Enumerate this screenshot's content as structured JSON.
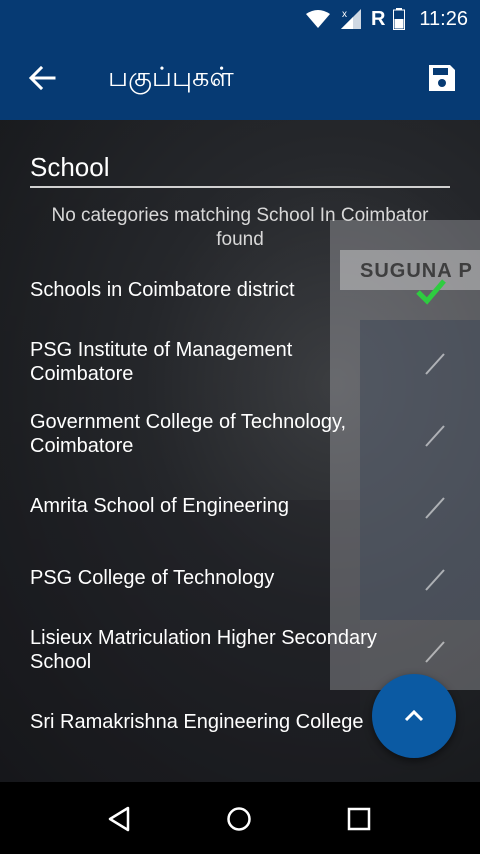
{
  "status_bar": {
    "time": "11:26",
    "network_letter": "R"
  },
  "app_bar": {
    "title": "பகுப்புகள்"
  },
  "search": {
    "value": "School"
  },
  "no_match_text": "No categories matching School In Coimbator found",
  "background_sign_text": "SUGUNA P",
  "items": [
    {
      "label": "Schools in Coimbatore district",
      "selected": true
    },
    {
      "label": "PSG Institute of Management Coimbatore",
      "selected": false
    },
    {
      "label": "Government College of Technology, Coimbatore",
      "selected": false
    },
    {
      "label": "Amrita School of Engineering",
      "selected": false
    },
    {
      "label": "PSG College of Technology",
      "selected": false
    },
    {
      "label": "Lisieux Matriculation Higher Secondary School",
      "selected": false
    },
    {
      "label": "Sri Ramakrishna Engineering College",
      "selected": false
    }
  ],
  "icons": {
    "back": "arrow-left-icon",
    "save": "save-icon",
    "fab": "chevron-up-icon",
    "nav_back": "nav-back-icon",
    "nav_home": "nav-home-icon",
    "nav_recents": "nav-recents-icon"
  },
  "colors": {
    "primary": "#063a73",
    "fab": "#0b5aa3",
    "check_selected": "#2ecc40"
  }
}
